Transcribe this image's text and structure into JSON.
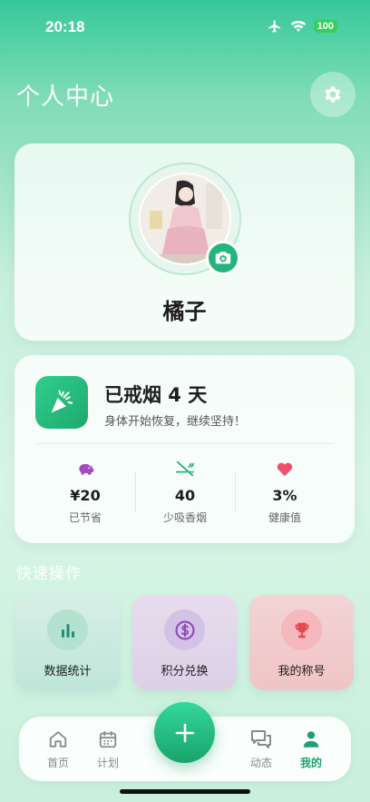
{
  "status_bar": {
    "time": "20:18",
    "battery": "100"
  },
  "header": {
    "title": "个人中心"
  },
  "profile": {
    "name": "橘子"
  },
  "quit_card": {
    "title": "已戒烟 4 天",
    "subtitle": "身体开始恢复，继续坚持！",
    "stats": [
      {
        "value": "¥20",
        "label": "已节省",
        "icon": "piggy-bank-icon",
        "color": "#a04cc0"
      },
      {
        "value": "40",
        "label": "少吸香烟",
        "icon": "no-smoking-icon",
        "color": "#27b27a"
      },
      {
        "value": "3%",
        "label": "健康值",
        "icon": "heart-icon",
        "color": "#f0506e"
      }
    ]
  },
  "quick_actions": {
    "title": "快速操作",
    "items": [
      {
        "label": "数据统计",
        "icon": "bar-chart-icon"
      },
      {
        "label": "积分兑换",
        "icon": "dollar-coin-icon"
      },
      {
        "label": "我的称号",
        "icon": "trophy-icon"
      }
    ]
  },
  "tab_bar": {
    "items": [
      {
        "label": "首页",
        "icon": "home-icon"
      },
      {
        "label": "计划",
        "icon": "calendar-icon"
      },
      {
        "label": "动态",
        "icon": "chat-icon"
      },
      {
        "label": "我的",
        "icon": "person-icon"
      }
    ],
    "active": "我的"
  },
  "colors": {
    "accent": "#1fa86f",
    "brand_green": "#2fcf8e"
  }
}
